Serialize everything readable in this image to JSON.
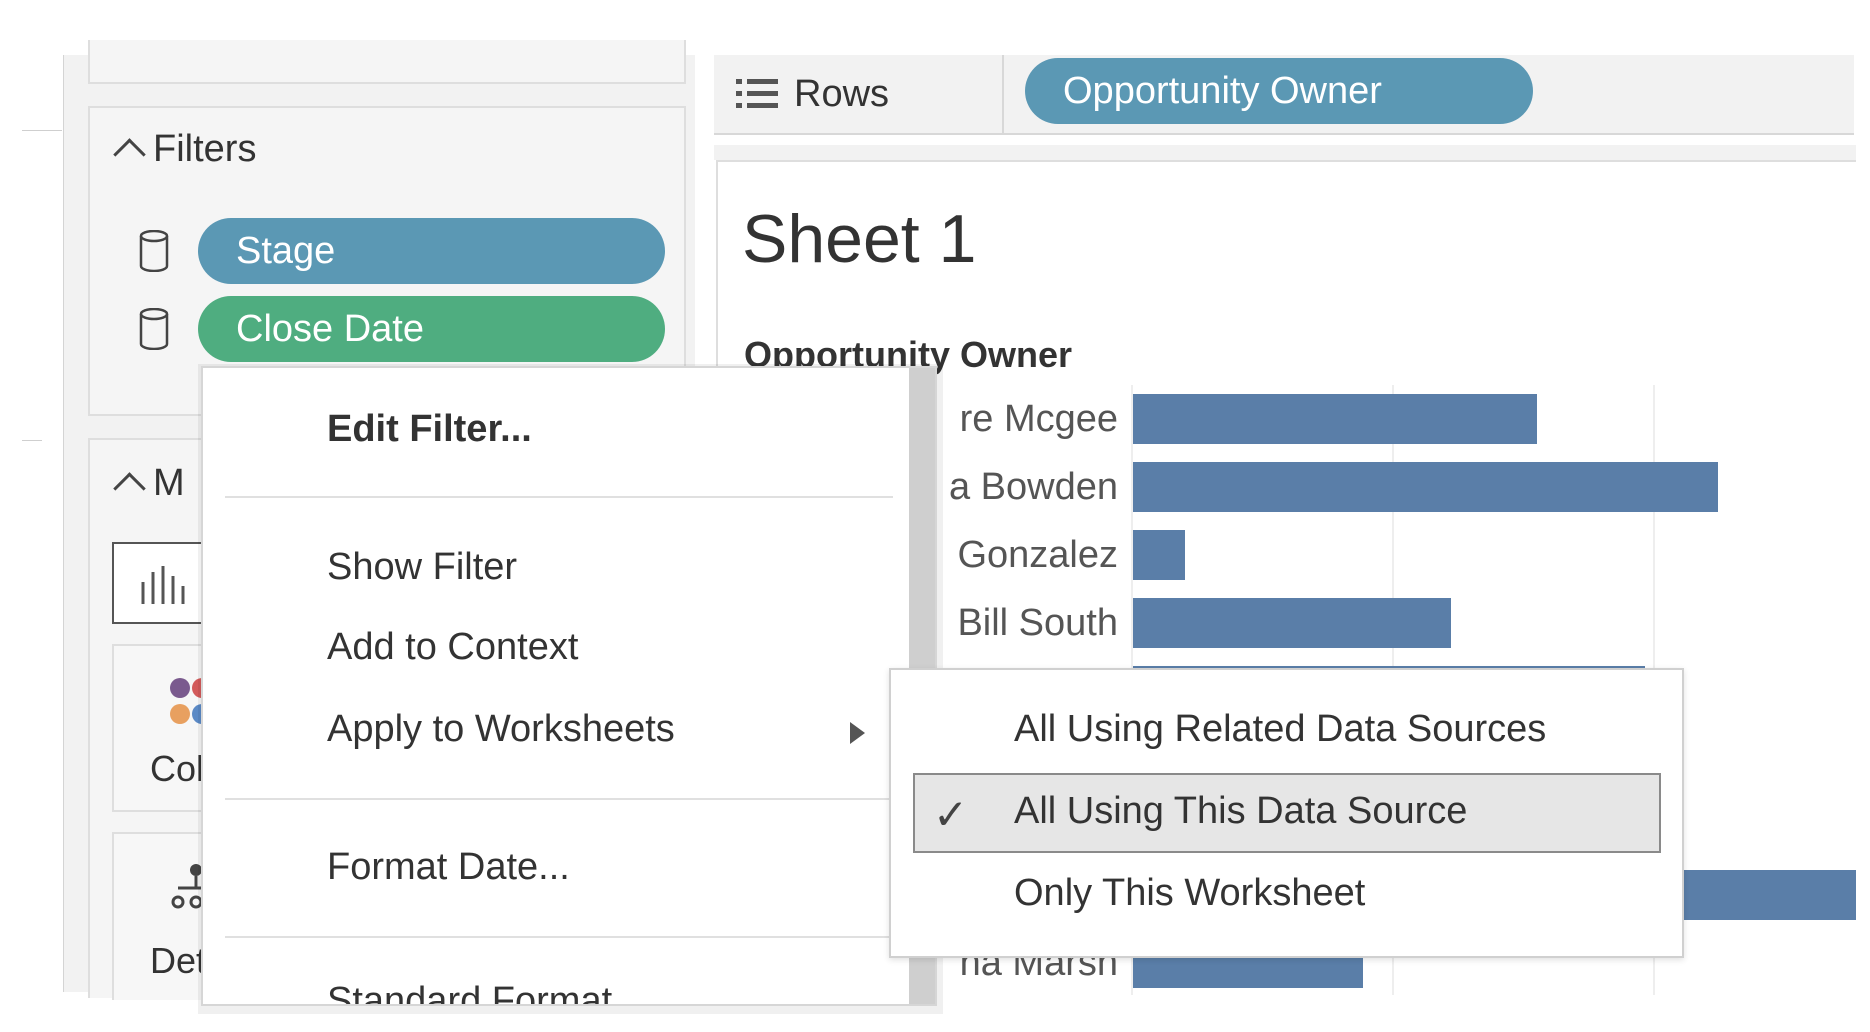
{
  "rows_shelf": {
    "label": "Rows",
    "pill": "Opportunity Owner"
  },
  "filters": {
    "title": "Filters",
    "items": [
      {
        "label": "Stage",
        "color": "#5b98b4"
      },
      {
        "label": "Close Date",
        "color": "#4fad80"
      }
    ]
  },
  "marks": {
    "title_visible": "M",
    "color_label_visible": "Col",
    "detail_label_visible": "Det"
  },
  "sheet": {
    "title": "Sheet 1",
    "column_header": "Opportunity Owner",
    "row_labels": [
      "re Mcgee",
      "a Bowden",
      "Gonzalez",
      "Bill South",
      "na Marsh"
    ],
    "bar_color": "#5a7ea8"
  },
  "context_menu": {
    "items": [
      {
        "label": "Edit Filter...",
        "bold": true
      },
      {
        "label": "Show Filter"
      },
      {
        "label": "Add to Context"
      },
      {
        "label": "Apply to Worksheets",
        "has_submenu": true
      },
      {
        "label": "Format Date..."
      },
      {
        "label": "Standard Format"
      }
    ]
  },
  "submenu": {
    "items": [
      {
        "label": "All Using Related Data Sources",
        "checked": false
      },
      {
        "label": "All Using This Data Source",
        "checked": true
      },
      {
        "label": "Only This Worksheet",
        "checked": false
      }
    ],
    "check_glyph": "✓"
  }
}
